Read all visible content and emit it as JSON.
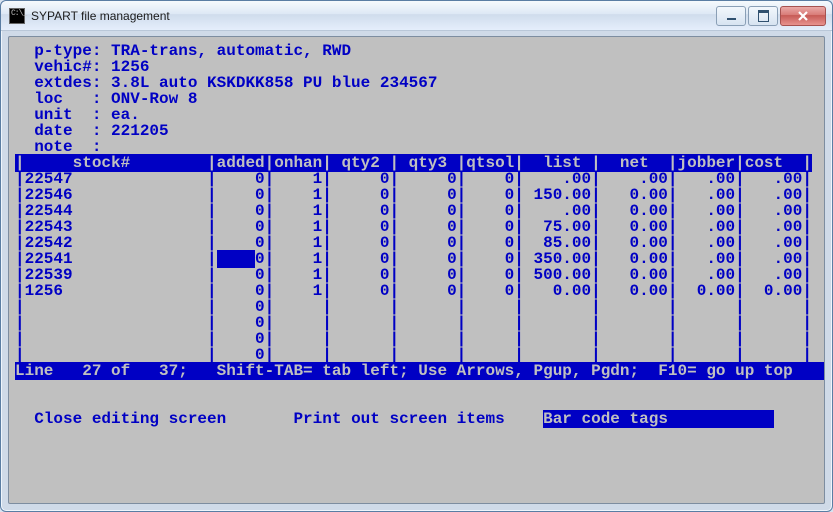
{
  "window": {
    "title": "SYPART file management"
  },
  "header": {
    "labels": {
      "ptype": "p-type:",
      "vehic": "vehic#:",
      "extdes": "extdes:",
      "loc": "loc   :",
      "unit": "unit  :",
      "date": "date  :",
      "note": "note  :"
    },
    "ptype": "TRA-trans, automatic, RWD",
    "vehic": "1256",
    "extdes": "3.8L auto KSKDKK858 PU blue 234567",
    "loc": "ONV-Row 8",
    "unit": "ea.",
    "date": "221205",
    "note": ""
  },
  "columns": [
    "stock#",
    "added",
    "onhan",
    "qty2",
    "qty3",
    "qtsol",
    "list",
    "net",
    "jobber",
    "cost"
  ],
  "column_header_raw": "|     stock#        |added|onhan| qty2 | qty3 |qtsol|  list |  net  |jobber|cost  |",
  "rows": [
    {
      "stock": "22547",
      "added": "0",
      "onhan": "1",
      "qty2": "0",
      "qty3": "0",
      "qtsol": "0",
      "list": ".00",
      "net": ".00",
      "jobber": ".00",
      "cost": ".00",
      "selected": false
    },
    {
      "stock": "22546",
      "added": "0",
      "onhan": "1",
      "qty2": "0",
      "qty3": "0",
      "qtsol": "0",
      "list": "150.00",
      "net": "0.00",
      "jobber": ".00",
      "cost": ".00",
      "selected": false
    },
    {
      "stock": "22544",
      "added": "0",
      "onhan": "1",
      "qty2": "0",
      "qty3": "0",
      "qtsol": "0",
      "list": ".00",
      "net": "0.00",
      "jobber": ".00",
      "cost": ".00",
      "selected": false
    },
    {
      "stock": "22543",
      "added": "0",
      "onhan": "1",
      "qty2": "0",
      "qty3": "0",
      "qtsol": "0",
      "list": "75.00",
      "net": "0.00",
      "jobber": ".00",
      "cost": ".00",
      "selected": false
    },
    {
      "stock": "22542",
      "added": "0",
      "onhan": "1",
      "qty2": "0",
      "qty3": "0",
      "qtsol": "0",
      "list": "85.00",
      "net": "0.00",
      "jobber": ".00",
      "cost": ".00",
      "selected": false
    },
    {
      "stock": "22541",
      "added": "0",
      "onhan": "1",
      "qty2": "0",
      "qty3": "0",
      "qtsol": "0",
      "list": "350.00",
      "net": "0.00",
      "jobber": ".00",
      "cost": ".00",
      "selected": true
    },
    {
      "stock": "22539",
      "added": "0",
      "onhan": "1",
      "qty2": "0",
      "qty3": "0",
      "qtsol": "0",
      "list": "500.00",
      "net": "0.00",
      "jobber": ".00",
      "cost": ".00",
      "selected": false
    },
    {
      "stock": "1256",
      "added": "0",
      "onhan": "1",
      "qty2": "0",
      "qty3": "0",
      "qtsol": "0",
      "list": "0.00",
      "net": "0.00",
      "jobber": "0.00",
      "cost": "0.00",
      "selected": false
    }
  ],
  "empty_added_rows": [
    "0",
    "0",
    "0",
    "0"
  ],
  "status": {
    "line_label": "Line",
    "pos": "27",
    "of_label": "of",
    "total": "37",
    "hints": "Shift-TAB= tab left; Use Arrows, Pgup, Pgdn;  F10= go up top"
  },
  "footer": {
    "close": "Close editing screen",
    "print": "Print out screen items",
    "barcode": "Bar code tags"
  },
  "widths": {
    "stock": 19,
    "added": 5,
    "onhan": 5,
    "qty2": 6,
    "qty3": 6,
    "qtsol": 5,
    "list": 7,
    "net": 7,
    "jobber": 6,
    "cost": 6
  }
}
